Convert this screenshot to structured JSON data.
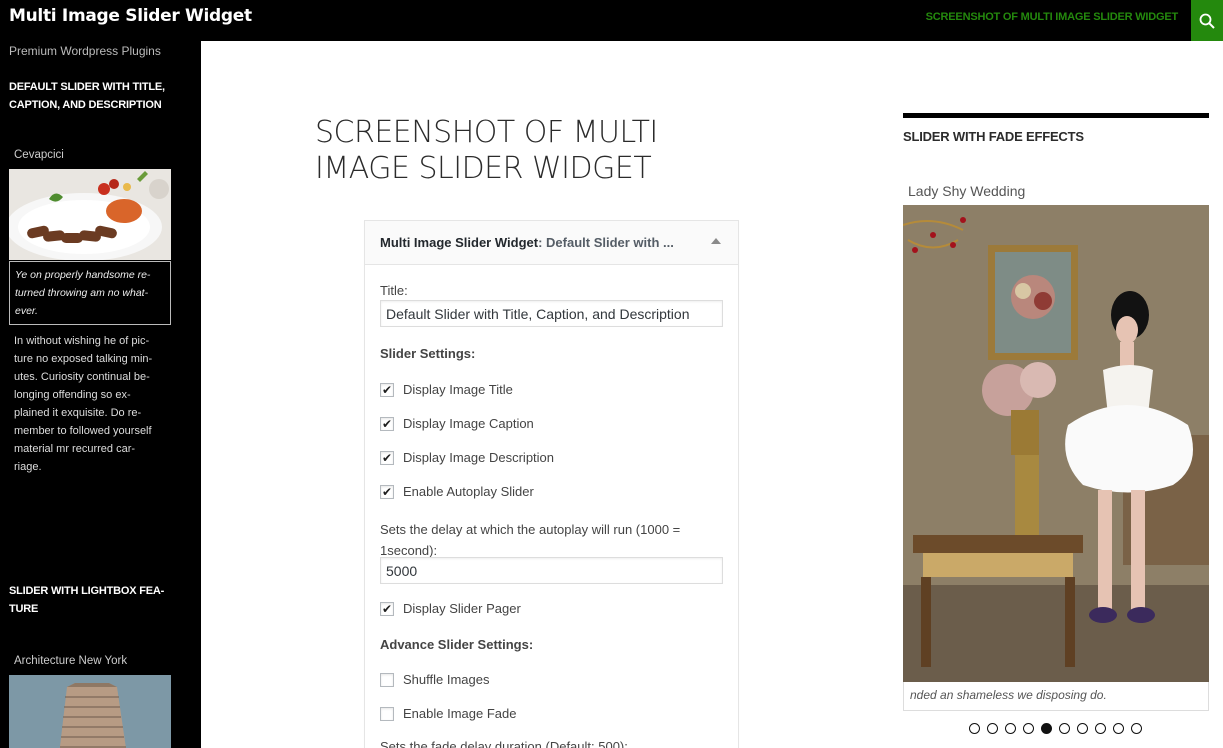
{
  "header": {
    "site_title": "Multi Image Slider Widget",
    "nav_link": "SCREENSHOT OF MULTI IMAGE SLIDER WIDGET",
    "search_icon": "search-icon",
    "accent": "#24890d"
  },
  "sidebar": {
    "tagline": "Premium Wordpress Plugins",
    "widget1": {
      "title_line1": "DEFAULT SLIDER WITH TITLE,",
      "title_line2": "CAPTION, AND DESCRIPTION",
      "slide_title": "Cevapcici",
      "caption_lines": [
        "Ye on properly handsome re-",
        "turned throwing am no what-",
        "ever."
      ],
      "description_lines": [
        "In without wishing he of pic-",
        "ture no exposed talking min-",
        "utes. Curiosity continual be-",
        "longing offending so ex-",
        "plained it exquisite. Do re-",
        "member to followed yourself",
        "material mr recurred car-",
        "riage."
      ]
    },
    "widget2": {
      "title_line1": "SLIDER WITH LIGHTBOX FEA-",
      "title_line2": "TURE",
      "slide_title": "Architecture New York"
    }
  },
  "main": {
    "page_title_line1": "SCREENSHOT OF MULTI",
    "page_title_line2": "IMAGE SLIDER WIDGET",
    "panel": {
      "header_main": "Multi Image Slider Widget",
      "header_sub": ": Default Slider with ...",
      "title_label": "Title:",
      "title_value": "Default Slider with Title, Caption, and Description",
      "slider_settings_label": "Slider Settings:",
      "checkboxes": [
        {
          "label": "Display Image Title",
          "checked": true
        },
        {
          "label": "Display Image Caption",
          "checked": true
        },
        {
          "label": "Display Image Description",
          "checked": true
        },
        {
          "label": "Enable Autoplay Slider",
          "checked": true
        }
      ],
      "delay_label_line1": "Sets the delay at which the autoplay will run (1000 =",
      "delay_label_line2": "1second):",
      "delay_value": "5000",
      "pager_checkbox": {
        "label": "Display Slider Pager",
        "checked": true
      },
      "advance_label": "Advance Slider Settings:",
      "advance_checkboxes": [
        {
          "label": "Shuffle Images",
          "checked": false
        },
        {
          "label": "Enable Image Fade",
          "checked": false
        }
      ],
      "fade_label": "Sets the fade delay duration (Default: 500):"
    }
  },
  "right": {
    "widget_title": "SLIDER WITH FADE EFFECTS",
    "slide_title": "Lady Shy Wedding",
    "caption": "nded an shameless we disposing do.",
    "pager_count": 10,
    "pager_active_index": 4
  }
}
